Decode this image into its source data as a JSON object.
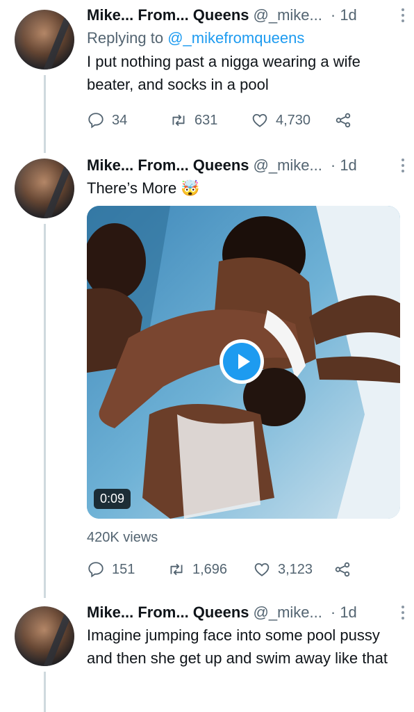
{
  "tweets": [
    {
      "name": "Mike... From... Queens",
      "handle": "@_mike...",
      "time": "· 1d",
      "replying_prefix": "Replying to ",
      "replying_handle": "@_mikefromqueens",
      "text": "I put nothing past a nigga wearing a wife beater, and socks in a pool",
      "replies": "34",
      "retweets": "631",
      "likes": "4,730"
    },
    {
      "name": "Mike... From... Queens",
      "handle": "@_mike...",
      "time": "· 1d",
      "text": "There’s More 🤯",
      "video_duration": "0:09",
      "views": "420K views",
      "replies": "151",
      "retweets": "1,696",
      "likes": "3,123"
    },
    {
      "name": "Mike... From... Queens",
      "handle": "@_mike...",
      "time": "· 1d",
      "text": "Imagine jumping face into some pool pussy and then she get up and swim away like that"
    }
  ],
  "icons": {
    "reply": "reply-icon",
    "retweet": "retweet-icon",
    "like": "heart-icon",
    "share": "share-icon",
    "more": "more-icon",
    "play": "play-icon"
  },
  "colors": {
    "accent": "#1d9bf0",
    "secondary_text": "#536471",
    "thread_line": "#cfd9de"
  }
}
